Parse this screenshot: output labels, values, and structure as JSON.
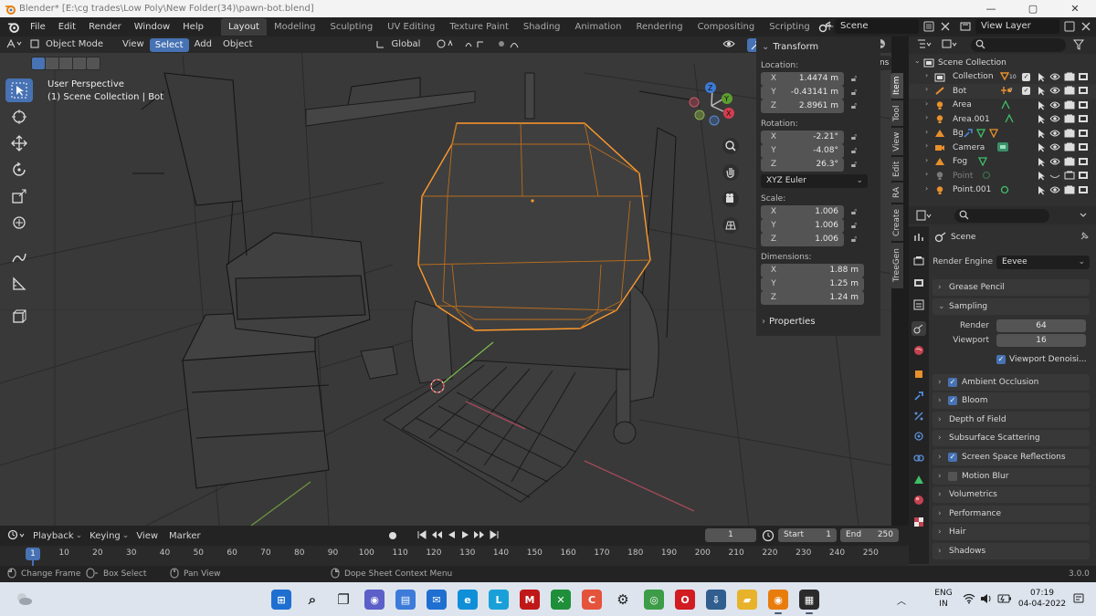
{
  "titlebar": {
    "title": "Blender* [E:\\cg trades\\Low Poly\\New Folder(34)\\pawn-bot.blend]",
    "minimize": "—",
    "maximize": "▢",
    "close": "✕"
  },
  "menu": {
    "items": [
      "File",
      "Edit",
      "Render",
      "Window",
      "Help"
    ],
    "workspaces": [
      "Layout",
      "Modeling",
      "Sculpting",
      "UV Editing",
      "Texture Paint",
      "Shading",
      "Animation",
      "Rendering",
      "Compositing",
      "Scripting"
    ],
    "add_workspace": "+",
    "scene_field": "Scene",
    "viewlayer_field": "View Layer"
  },
  "viewport": {
    "mode": "Object Mode",
    "menus": [
      "View",
      "Select",
      "Add",
      "Object"
    ],
    "transform_orientation": "Global",
    "options_label": "Options",
    "overlay_line1": "User Perspective",
    "overlay_line2": "(1) Scene Collection | Bot",
    "gizmo": {
      "x": "X",
      "y": "Y",
      "z": "Z"
    }
  },
  "npanel": {
    "transform_title": "Transform",
    "location_label": "Location:",
    "location": [
      {
        "axis": "X",
        "value": "1.4474 m"
      },
      {
        "axis": "Y",
        "value": "-0.43141 m"
      },
      {
        "axis": "Z",
        "value": "2.8961 m"
      }
    ],
    "rotation_label": "Rotation:",
    "rotation": [
      {
        "axis": "X",
        "value": "-2.21°"
      },
      {
        "axis": "Y",
        "value": "-4.08°"
      },
      {
        "axis": "Z",
        "value": "26.3°"
      }
    ],
    "rotation_mode": "XYZ Euler",
    "scale_label": "Scale:",
    "scale": [
      {
        "axis": "X",
        "value": "1.006"
      },
      {
        "axis": "Y",
        "value": "1.006"
      },
      {
        "axis": "Z",
        "value": "1.006"
      }
    ],
    "dimensions_label": "Dimensions:",
    "dimensions": [
      {
        "axis": "X",
        "value": "1.88 m"
      },
      {
        "axis": "Y",
        "value": "1.25 m"
      },
      {
        "axis": "Z",
        "value": "1.24 m"
      }
    ],
    "properties_title": "Properties",
    "tabs": [
      "Item",
      "Tool",
      "View",
      "Edit",
      "RA",
      "Create",
      "TreeGen"
    ]
  },
  "outliner": {
    "root": "Scene Collection",
    "items": [
      {
        "name": "Collection",
        "badge": "10",
        "dim": false
      },
      {
        "name": "Bot",
        "badge": "7",
        "dim": false
      },
      {
        "name": "Area",
        "badge": "",
        "dim": false
      },
      {
        "name": "Area.001",
        "badge": "",
        "dim": false
      },
      {
        "name": "Bg",
        "badge": "",
        "dim": false
      },
      {
        "name": "Camera",
        "badge": "",
        "dim": false
      },
      {
        "name": "Fog",
        "badge": "",
        "dim": false
      },
      {
        "name": "Point",
        "badge": "",
        "dim": true
      },
      {
        "name": "Point.001",
        "badge": "",
        "dim": false
      }
    ]
  },
  "properties": {
    "context": "Scene",
    "render_engine_label": "Render Engine",
    "render_engine": "Eevee",
    "sections": [
      {
        "label": "Grease Pencil",
        "check": "none",
        "open": false
      },
      {
        "label": "Sampling",
        "check": "none",
        "open": true
      },
      {
        "label": "Ambient Occlusion",
        "check": "on",
        "open": false
      },
      {
        "label": "Bloom",
        "check": "on",
        "open": false
      },
      {
        "label": "Depth of Field",
        "check": "none",
        "open": false
      },
      {
        "label": "Subsurface Scattering",
        "check": "none",
        "open": false
      },
      {
        "label": "Screen Space Reflections",
        "check": "on",
        "open": false
      },
      {
        "label": "Motion Blur",
        "check": "off",
        "open": false
      },
      {
        "label": "Volumetrics",
        "check": "none",
        "open": false
      },
      {
        "label": "Performance",
        "check": "none",
        "open": false
      },
      {
        "label": "Hair",
        "check": "none",
        "open": false
      },
      {
        "label": "Shadows",
        "check": "none",
        "open": false
      }
    ],
    "sampling_render_label": "Render",
    "sampling_render": "64",
    "sampling_viewport_label": "Viewport",
    "sampling_viewport": "16",
    "viewport_denoise": "Viewport Denoisi..."
  },
  "timeline": {
    "menus": [
      "Playback",
      "Keying",
      "View",
      "Marker"
    ],
    "current_frame": "1",
    "start_label": "Start",
    "start": "1",
    "end_label": "End",
    "end": "250",
    "ticks": [
      "1",
      "10",
      "20",
      "30",
      "40",
      "50",
      "60",
      "70",
      "80",
      "90",
      "100",
      "110",
      "120",
      "130",
      "140",
      "150",
      "160",
      "170",
      "180",
      "190",
      "200",
      "210",
      "220",
      "230",
      "240",
      "250"
    ]
  },
  "statusbar": {
    "hints": [
      "Change Frame",
      "Box Select",
      "Pan View",
      "Dope Sheet Context Menu"
    ],
    "version": "3.0.0"
  },
  "taskbar": {
    "lang": "ENG",
    "region": "IN",
    "time": "07:19",
    "date": "04-04-2022",
    "apps": [
      "start",
      "search",
      "task-view",
      "chat",
      "widgets",
      "mail",
      "edge",
      "lasso",
      "mcafee",
      "xbox",
      "app-c",
      "settings",
      "chrome",
      "opera",
      "installer",
      "explorer",
      "blender",
      "notes"
    ]
  },
  "colors": {
    "accent": "#4772b3",
    "selection_outline": "#ff9a2e",
    "viewport_bg": "#393939"
  }
}
